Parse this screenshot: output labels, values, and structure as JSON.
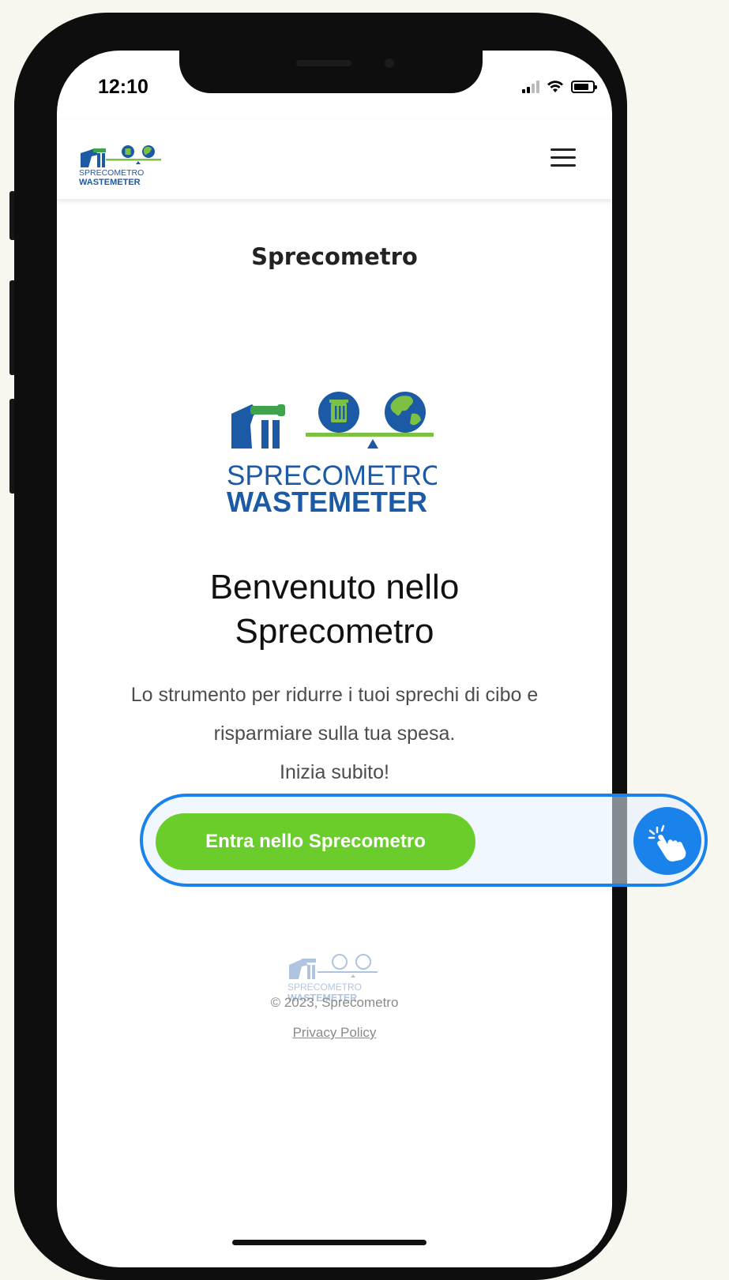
{
  "status_bar": {
    "time": "12:10"
  },
  "header": {
    "logo_line1": "SPRECOMETRO",
    "logo_line2": "WASTEMETER"
  },
  "page": {
    "title": "Sprecometro",
    "logo_line1": "SPRECOMETRO",
    "logo_line2": "WASTEMETER",
    "heading_line1": "Benvenuto nello",
    "heading_line2": "Sprecometro",
    "intro_line1": "Lo strumento per ridurre i tuoi sprechi di cibo e",
    "intro_line2": "risparmiare sulla tua spesa.",
    "intro_line3": "Inizia subito!",
    "cta_label": "Entra nello Sprecometro"
  },
  "footer": {
    "logo_line1": "SPRECOMETRO",
    "logo_line2": "WASTEMETER",
    "copyright": "© 2023, Sprecometro",
    "privacy_link": "Privacy Policy"
  },
  "colors": {
    "brand_blue": "#1c5aa6",
    "brand_green": "#7dc142",
    "cta_green": "#6bcd2b",
    "highlight_blue": "#1a82eb"
  },
  "icons": [
    "signal-icon",
    "wifi-icon",
    "battery-icon",
    "menu-icon",
    "tap-hand-icon"
  ]
}
